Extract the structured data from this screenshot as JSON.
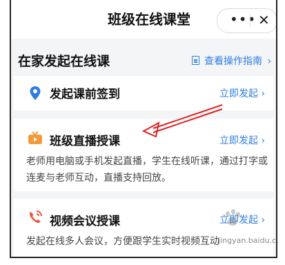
{
  "header": {
    "title": "班级在线课堂",
    "more_icon": "more-dots-icon",
    "more_label": "•••",
    "close_label": "✕"
  },
  "section": {
    "title": "在家发起在线课",
    "guide_label": "查看操作指南",
    "guide_chevron": "›"
  },
  "cards": [
    {
      "icon": "location-pin-icon",
      "title": "发起课前签到",
      "action": "立即发起",
      "chevron": "›"
    },
    {
      "icon": "tv-live-icon",
      "title": "班级直播授课",
      "action": "立即发起",
      "chevron": "›",
      "description": "老师用电脑或手机发起直播，学生在线听课，通过打字或连麦与老师互动，直播支持回放。"
    },
    {
      "icon": "phone-call-icon",
      "title": "视频会议授课",
      "action": "立即发起",
      "chevron": "›",
      "description": "发起在线多人会议，方便跟学生实时视频互动"
    }
  ],
  "overlay": {
    "arrow_color": "#e02020",
    "watermark": "jingyan.baidu.com"
  },
  "colors": {
    "accent": "#2f7de1",
    "pin": "#2f7de1",
    "tv": "#f39a3a",
    "phone": "#e8553a"
  }
}
